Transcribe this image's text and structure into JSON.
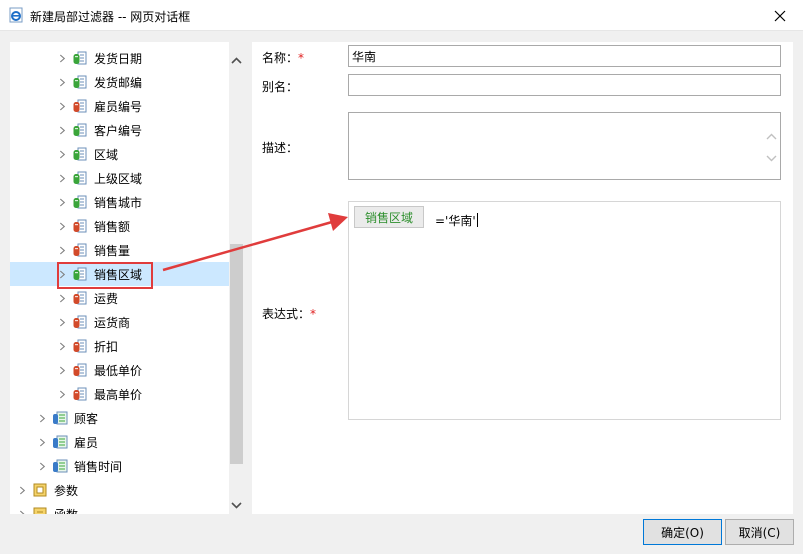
{
  "window": {
    "title": "新建局部过滤器 -- 网页对话框",
    "close_label": "✕"
  },
  "tree": {
    "items": [
      {
        "label": "发货日期",
        "icon": "field-green-icon"
      },
      {
        "label": "发货邮编",
        "icon": "field-green-icon"
      },
      {
        "label": "雇员编号",
        "icon": "field-red-icon"
      },
      {
        "label": "客户编号",
        "icon": "field-green-icon"
      },
      {
        "label": "区域",
        "icon": "field-green-icon"
      },
      {
        "label": "上级区域",
        "icon": "field-green-icon"
      },
      {
        "label": "销售城市",
        "icon": "field-green-icon"
      },
      {
        "label": "销售额",
        "icon": "field-red-icon"
      },
      {
        "label": "销售量",
        "icon": "field-red-icon"
      },
      {
        "label": "销售区域",
        "icon": "field-green-icon",
        "selected": true
      },
      {
        "label": "运费",
        "icon": "field-red-icon"
      },
      {
        "label": "运货商",
        "icon": "field-red-icon"
      },
      {
        "label": "折扣",
        "icon": "field-red-icon"
      },
      {
        "label": "最低单价",
        "icon": "field-red-icon"
      },
      {
        "label": "最高单价",
        "icon": "field-red-icon"
      },
      {
        "label": "顾客",
        "icon": "table-icon"
      },
      {
        "label": "雇员",
        "icon": "table-icon"
      },
      {
        "label": "销售时间",
        "icon": "table-icon"
      },
      {
        "label": "参数",
        "icon": "param-icon"
      },
      {
        "label": "函数",
        "icon": "function-icon"
      }
    ]
  },
  "form": {
    "name_label": "名称：",
    "name_value": "华南",
    "alias_label": "别名：",
    "alias_value": "",
    "desc_label": "描述：",
    "desc_value": "",
    "expr_label": "表达式：",
    "required_mark": "*",
    "expr_field_chip": "销售区域",
    "expr_text": "='华南'"
  },
  "buttons": {
    "ok": "确定(O)",
    "cancel": "取消(C)"
  },
  "colors": {
    "selection": "#cce8ff",
    "highlight_red": "#e03c3c",
    "chip_text_green": "#2d8f2d",
    "required_red": "#e02020"
  }
}
